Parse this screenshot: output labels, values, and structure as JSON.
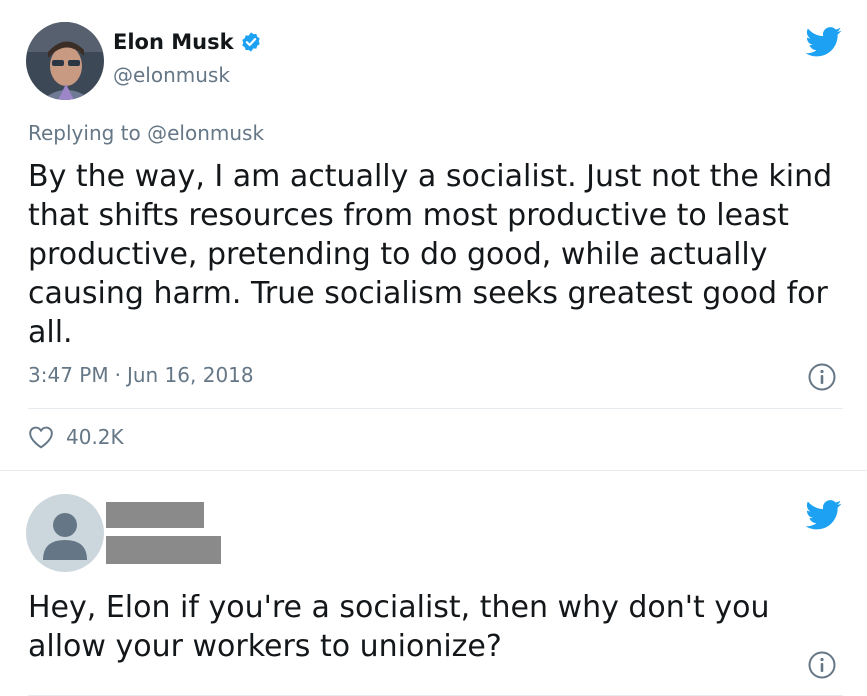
{
  "tweet1": {
    "display_name": "Elon Musk",
    "handle": "@elonmusk",
    "replying_to": "Replying to @elonmusk",
    "text": "By the way, I am actually a socialist. Just not the kind that shifts resources from most productive to least productive, pretending to do good, while actually causing harm. True socialism seeks greatest good for all.",
    "time": "3:47 PM",
    "separator": "·",
    "date": "Jun 16, 2018",
    "likes": "40.2K"
  },
  "tweet2": {
    "text": "Hey, Elon if you're a socialist, then why don't you allow your workers to unionize?"
  },
  "icons": {
    "brand": "twitter-bird-icon",
    "verified": "verified-badge-icon",
    "info": "info-icon",
    "like": "heart-icon"
  },
  "colors": {
    "brand_blue": "#1da1f2",
    "secondary_text": "#657786",
    "primary_text": "#14171a",
    "border": "#e6ecf0"
  }
}
